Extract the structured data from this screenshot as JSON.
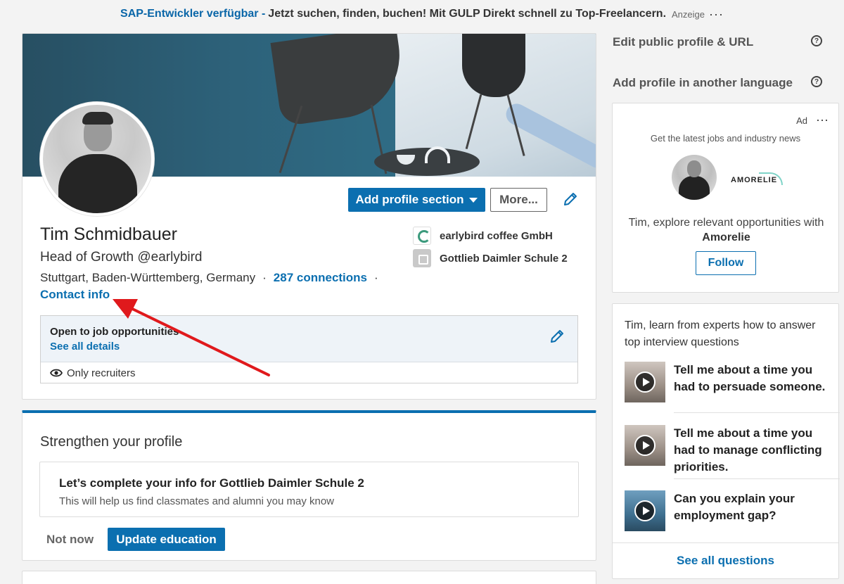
{
  "top_ad": {
    "link_text": "SAP-Entwickler verfügbar -",
    "text": "Jetzt suchen, finden, buchen! Mit GULP Direkt schnell zu Top-Freelancern.",
    "tag": "Anzeige",
    "dots": "···"
  },
  "profile": {
    "add_section_label": "Add profile section",
    "more_label": "More...",
    "name": "Tim Schmidbauer",
    "headline": "Head of Growth @earlybird",
    "location": "Stuttgart, Baden-Württemberg, Germany",
    "sep1": "·",
    "connections": "287 connections",
    "sep2": "·",
    "contact_info": "Contact info",
    "company": "earlybird coffee GmbH",
    "school": "Gottlieb Daimler Schule 2"
  },
  "job_box": {
    "title": "Open to job opportunities",
    "details_link": "See all details",
    "visibility": "Only recruiters"
  },
  "strength": {
    "title": "Strengthen your profile",
    "box_title": "Let’s complete your info for Gottlieb Daimler Schule 2",
    "box_sub": "This will help us find classmates and alumni you may know",
    "not_now": "Not now",
    "update_label": "Update education"
  },
  "sidebar": {
    "edit_public": "Edit public profile & URL",
    "add_language": "Add profile in another language",
    "help_glyph": "?"
  },
  "ad_card": {
    "label": "Ad",
    "dots": "···",
    "subtitle": "Get the latest jobs and industry news",
    "brand": "AMORELIE",
    "message_prefix": "Tim, explore relevant opportunities with",
    "message_brand": "Amorelie",
    "follow_label": "Follow"
  },
  "questions": {
    "intro": "Tim, learn from experts how to answer top interview questions",
    "items": [
      {
        "text": "Tell me about a time you had to persuade someone."
      },
      {
        "text": "Tell me about a time you had to manage conflicting priorities."
      },
      {
        "text": "Can you explain your employment gap?"
      }
    ],
    "see_all": "See all questions"
  },
  "colors": {
    "brand_blue": "#0b6fb0",
    "annotation_red": "#e0191c"
  }
}
